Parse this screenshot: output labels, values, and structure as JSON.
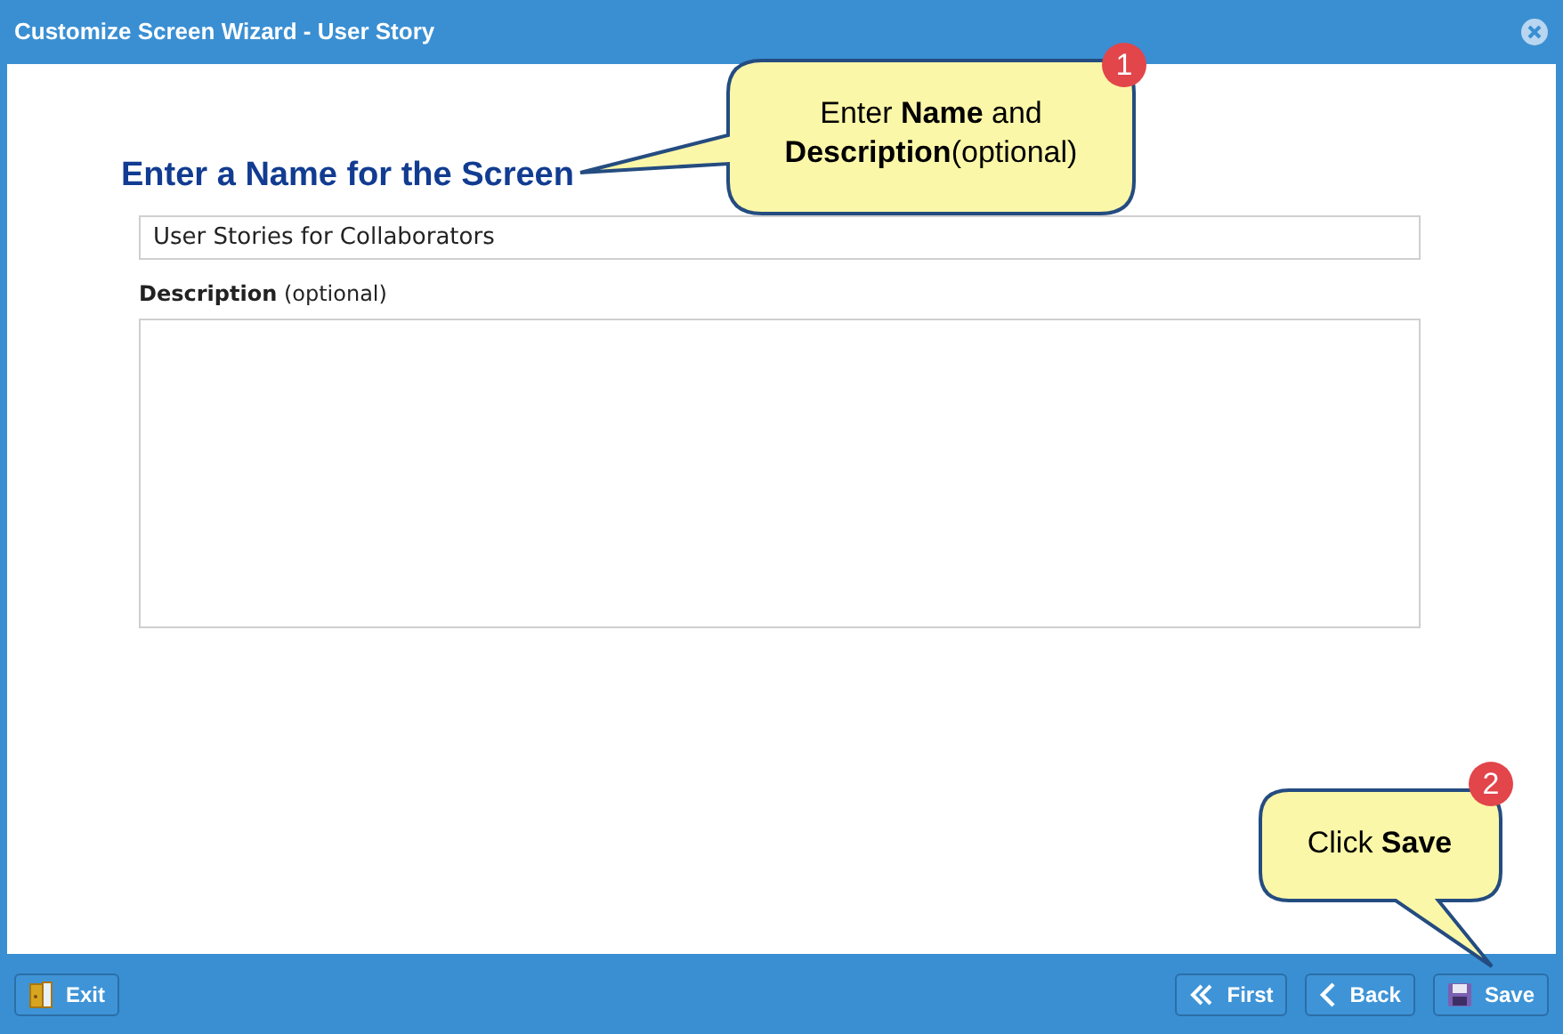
{
  "window": {
    "title": "Customize Screen Wizard - User Story"
  },
  "heading": "Enter a Name for the Screen",
  "name_field": {
    "value": "User Stories for Collaborators"
  },
  "description_field": {
    "label": "**Description** (optional)"
  },
  "callouts": [
    {
      "badge": "1",
      "text": "Enter **Name** and **Description**(optional)"
    },
    {
      "badge": "2",
      "text": "Click **Save**"
    }
  ],
  "footer": {
    "left": [
      {
        "label": "Exit",
        "kind": "exit"
      }
    ],
    "right": [
      {
        "label": "First",
        "kind": "first"
      },
      {
        "label": "Back",
        "kind": "back"
      },
      {
        "label": "Save",
        "kind": "save"
      }
    ]
  }
}
